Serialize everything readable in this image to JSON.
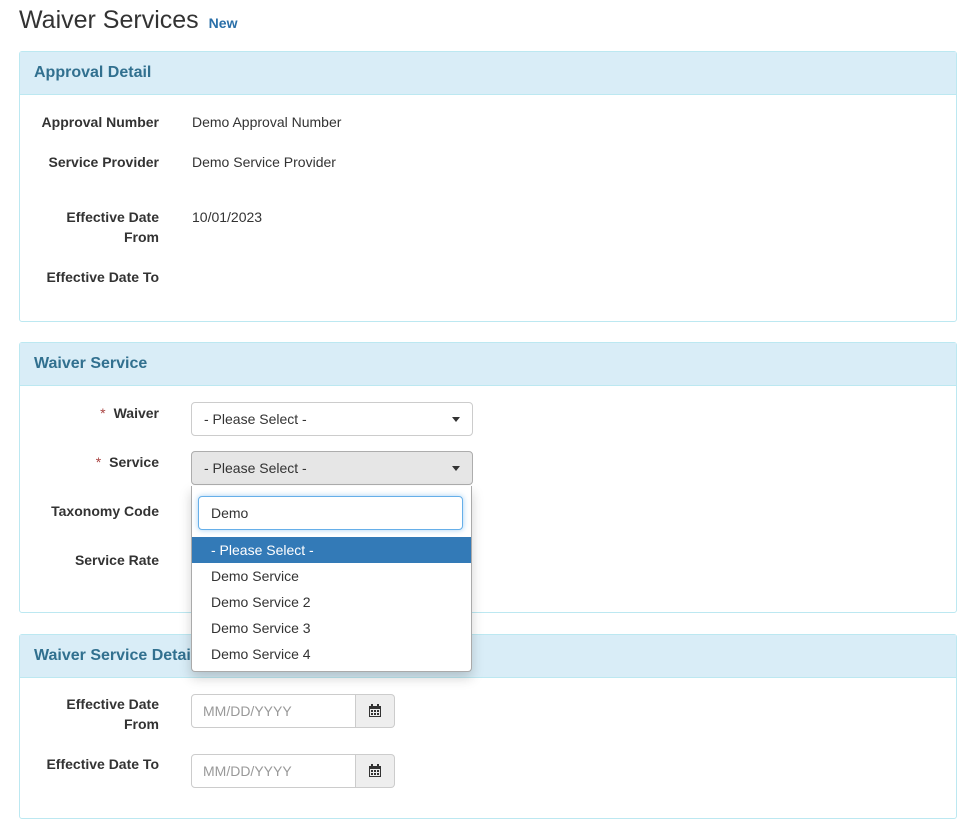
{
  "header": {
    "title": "Waiver Services",
    "badge": "New"
  },
  "approval_panel": {
    "title": "Approval Detail",
    "fields": [
      {
        "label": "Approval Number",
        "value": "Demo Approval Number"
      },
      {
        "label": "Service Provider",
        "value": "Demo Service Provider"
      },
      {
        "label_line1": "Effective Date",
        "label_line2": "From",
        "value": "10/01/2023"
      },
      {
        "label": "Effective Date To",
        "value": ""
      }
    ]
  },
  "waiver_panel": {
    "title": "Waiver Service",
    "waiver_label": "Waiver",
    "waiver_value": "- Please Select -",
    "service_label": "Service",
    "service_value": "- Please Select -",
    "taxonomy_label": "Taxonomy Code",
    "rate_label": "Service Rate",
    "required_mark": "*"
  },
  "detail_panel": {
    "title": "Waiver Service Details",
    "from_label_line1": "Effective Date",
    "from_label_line2": "From",
    "to_label": "Effective Date To",
    "date_placeholder": "MM/DD/YYYY"
  },
  "dropdown": {
    "search_value": "Demo",
    "options": [
      "- Please Select -",
      "Demo Service",
      "Demo Service 2",
      "Demo Service 3",
      "Demo Service 4"
    ],
    "selected_index": 0
  },
  "colors": {
    "panel_heading_bg": "#d9edf7",
    "panel_heading_text": "#31708f",
    "selected_option_bg": "#337ab7",
    "required_star": "#a94442"
  }
}
